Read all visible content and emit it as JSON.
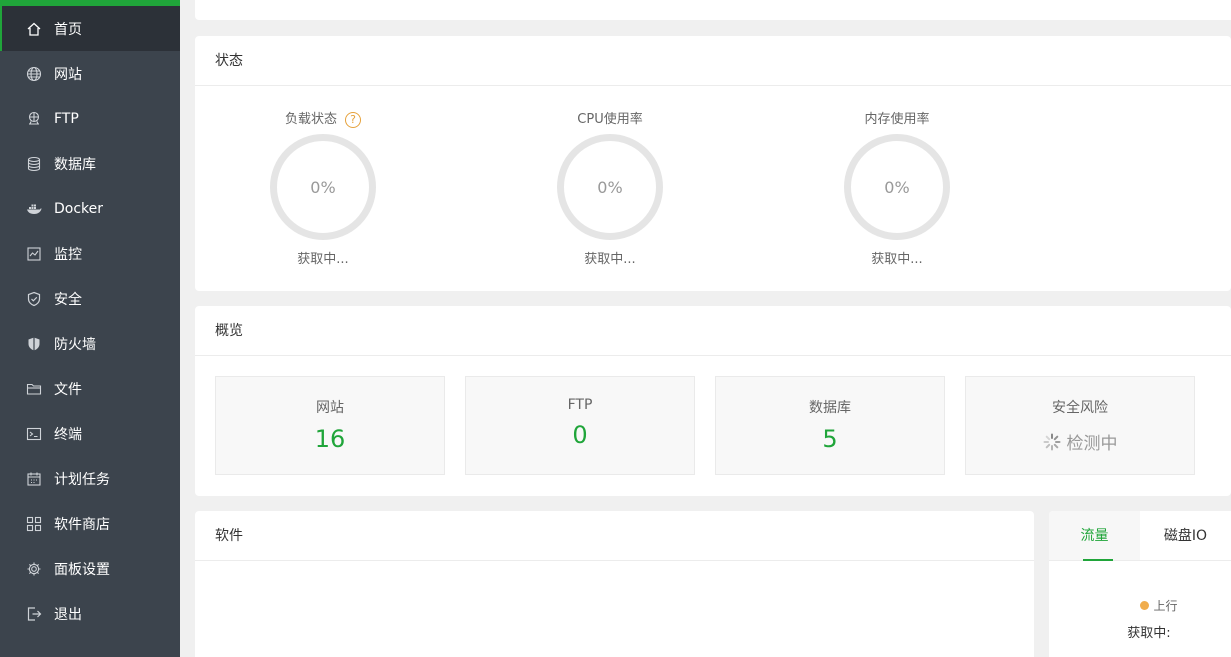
{
  "sidebar": {
    "items": [
      {
        "label": "首页",
        "icon": "home-icon"
      },
      {
        "label": "网站",
        "icon": "globe-icon"
      },
      {
        "label": "FTP",
        "icon": "ftp-icon"
      },
      {
        "label": "数据库",
        "icon": "database-icon"
      },
      {
        "label": "Docker",
        "icon": "docker-icon"
      },
      {
        "label": "监控",
        "icon": "monitor-icon"
      },
      {
        "label": "安全",
        "icon": "shield-check-icon"
      },
      {
        "label": "防火墙",
        "icon": "firewall-shield-icon"
      },
      {
        "label": "文件",
        "icon": "folder-icon"
      },
      {
        "label": "终端",
        "icon": "terminal-icon"
      },
      {
        "label": "计划任务",
        "icon": "calendar-icon"
      },
      {
        "label": "软件商店",
        "icon": "grid-apps-icon"
      },
      {
        "label": "面板设置",
        "icon": "gear-icon"
      },
      {
        "label": "退出",
        "icon": "logout-icon"
      }
    ],
    "active_index": 0
  },
  "status": {
    "title": "状态",
    "gauges": [
      {
        "label": "负载状态",
        "value": "0%",
        "status": "获取中...",
        "has_help": true
      },
      {
        "label": "CPU使用率",
        "value": "0%",
        "status": "获取中...",
        "has_help": false
      },
      {
        "label": "内存使用率",
        "value": "0%",
        "status": "获取中...",
        "has_help": false
      }
    ],
    "help_symbol": "?"
  },
  "overview": {
    "title": "概览",
    "items": [
      {
        "label": "网站",
        "value": "16"
      },
      {
        "label": "FTP",
        "value": "0"
      },
      {
        "label": "数据库",
        "value": "5"
      },
      {
        "label": "安全风险",
        "value": "检测中"
      }
    ]
  },
  "software": {
    "title": "软件"
  },
  "traffic": {
    "tabs": [
      "流量",
      "磁盘IO"
    ],
    "active_tab": 0,
    "legend": "上行",
    "fetching": "获取中:"
  },
  "colors": {
    "accent": "#20a53a",
    "sidebar": "#3c444d",
    "warning": "#f0ad4e"
  }
}
